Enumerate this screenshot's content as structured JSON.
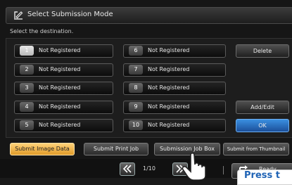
{
  "title_bar": {
    "title": "Select Submission Mode",
    "icon": "edit-form-icon"
  },
  "prompt": "Select the destination.",
  "destinations": [
    {
      "number": "1",
      "label": "Not Registered",
      "selected": true
    },
    {
      "number": "2",
      "label": "Not Registered",
      "selected": false
    },
    {
      "number": "3",
      "label": "Not Registered",
      "selected": false
    },
    {
      "number": "4",
      "label": "Not Registered",
      "selected": false
    },
    {
      "number": "5",
      "label": "Not Registered",
      "selected": false
    },
    {
      "number": "6",
      "label": "Not Registered",
      "selected": false
    },
    {
      "number": "7",
      "label": "Not Registered",
      "selected": false
    },
    {
      "number": "8",
      "label": "Not Registered",
      "selected": false
    },
    {
      "number": "9",
      "label": "Not Registered",
      "selected": false
    },
    {
      "number": "10",
      "label": "Not Registered",
      "selected": false
    }
  ],
  "actions": {
    "delete": "Delete",
    "add_edit": "Add/Edit",
    "ok": "OK"
  },
  "submission_modes": [
    {
      "label": "Submit Image Data",
      "active": true
    },
    {
      "label": "Submit Print Job",
      "active": false
    },
    {
      "label": "Submission Job Box",
      "active": false
    },
    {
      "label": "Submit from Thumbnail",
      "active": false
    }
  ],
  "pager": {
    "prev_icon": "double-chevron-left-icon",
    "next_icon": "double-chevron-right-icon",
    "indicator": "1/10"
  },
  "ready": {
    "label": "Ready",
    "icon": "return-arrow-icon"
  },
  "callout": {
    "text": "Press t"
  },
  "colors": {
    "accent_blue": "#2f7fd6",
    "active_mode": "#f0b24a",
    "background": "#161616"
  }
}
